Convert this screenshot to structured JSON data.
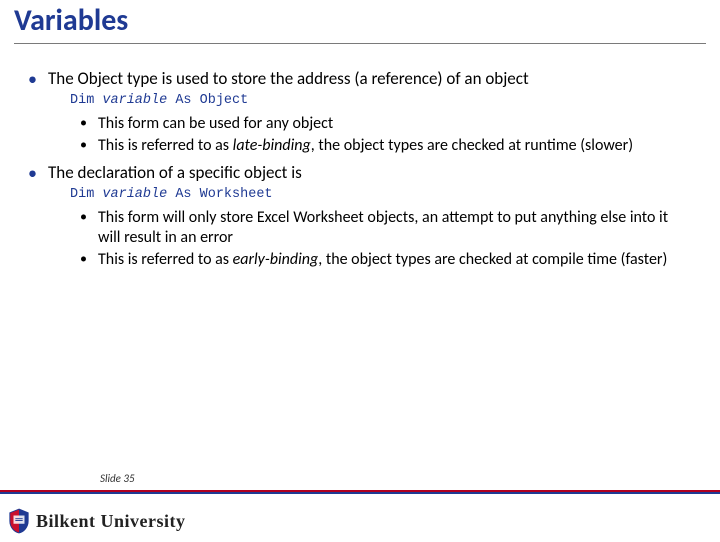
{
  "title": "Variables",
  "bullets": {
    "p1": "The Object type is used to store the address (a reference) of an object",
    "code1_pre": "Dim ",
    "code1_var": "variable",
    "code1_post": " As Object",
    "p1_sub1": "This form can be used for any object",
    "p1_sub2a": "This is referred to as ",
    "p1_sub2_em": "late-binding",
    "p1_sub2b": ", the object types are checked at runtime (slower)",
    "p2": "The declaration of a specific object is",
    "code2_pre": "Dim ",
    "code2_var": "variable",
    "code2_post": " As Worksheet",
    "p2_sub1": "This form will only store Excel Worksheet objects, an attempt to put anything else into it will result in an error",
    "p2_sub2a": "This is referred to as ",
    "p2_sub2_em": "early-binding",
    "p2_sub2b": ", the object types are checked at compile time (faster)"
  },
  "footer": {
    "slide_label": "Slide 35",
    "university": "Bilkent University"
  }
}
